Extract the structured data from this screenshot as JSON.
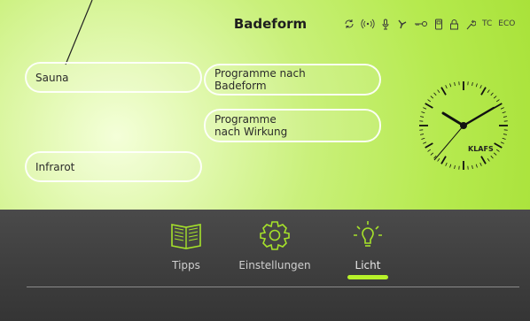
{
  "header": {
    "title": "Badeform",
    "status": {
      "icons": [
        "sync-icon",
        "wireless-icon",
        "microphone-icon",
        "fan-icon",
        "key-icon",
        "phone-icon",
        "lock-icon",
        "wrench-icon"
      ],
      "tc": "TC",
      "eco": "ECO"
    }
  },
  "buttons": {
    "sauna": "Sauna",
    "infrarot": "Infrarot",
    "programme_badeform": "Programme nach\nBadeform",
    "programme_wirkung": "Programme\nnach Wirkung"
  },
  "clock": {
    "brand": "KLAFS",
    "time": "10:08:38"
  },
  "dock": {
    "items": [
      {
        "label": "Tipps",
        "icon": "book-icon",
        "active": false
      },
      {
        "label": "Einstellungen",
        "icon": "gear-icon",
        "active": false
      },
      {
        "label": "Licht",
        "icon": "lightbulb-icon",
        "active": true
      }
    ]
  },
  "colors": {
    "accent": "#b8f22a",
    "background_top": "#b6ea4f",
    "background_bottom": "#3d3d3d"
  }
}
